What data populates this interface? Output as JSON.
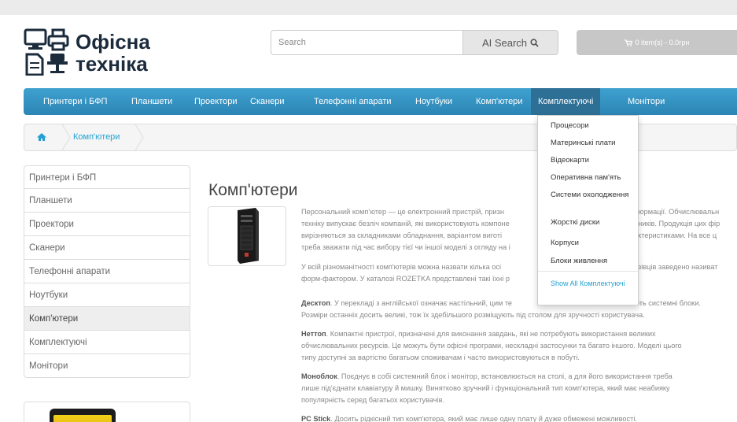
{
  "logo": {
    "line1": "Офісна",
    "line2": "техніка"
  },
  "search": {
    "placeholder": "Search",
    "button_label": "AI Search"
  },
  "cart": {
    "label": "0 item(s) - 0.0грн"
  },
  "nav": {
    "items": [
      "Принтери і БФП",
      "Планшети",
      "Проектори",
      "Сканери",
      "Телефонні апарати",
      "Ноутбуки",
      "Комп'ютери",
      "Комплектуючі",
      "Монітори"
    ],
    "active_index": 7
  },
  "dropdown": {
    "items": [
      "Процесори",
      "Материнські плати",
      "Відеокарти",
      "Оперативна пам'ять",
      "Системи охолодження",
      "Жорсткі диски",
      "Корпуси",
      "Блоки живлення"
    ],
    "show_all": "Show All Комплектуючі"
  },
  "breadcrumb": {
    "current": "Комп'ютери"
  },
  "sidebar": {
    "items": [
      "Принтери і БФП",
      "Планшети",
      "Проектори",
      "Сканери",
      "Телефонні апарати",
      "Ноутбуки",
      "Комп'ютери",
      "Комплектуючі",
      "Монітори"
    ],
    "active_index": 6
  },
  "page": {
    "title": "Комп'ютери",
    "paragraphs": [
      {
        "bold": "",
        "text": "Персональний комп'ютер — це електронний пристрій, призн"
      },
      {
        "bold": "",
        "text": "техніку випускає безліч компаній, які використовують компоне"
      },
      {
        "bold": "",
        "text": "вирізняються за складниками обладнання, варіантом виготі"
      },
      {
        "bold": "",
        "text": "треба зважати під час вибору тієї чи іншої моделі з огляду на і"
      },
      {
        "bold": "",
        "text": "У всій різноманітності комп'ютерів можна назвати кілька осі"
      },
      {
        "bold": "",
        "text": "форм-фактором. У каталозі ROZETKA представлені такі їхні р"
      },
      {
        "bold": "Десктоп",
        "text": ". У перекладі з англійської означає настільний, цим те"
      },
      {
        "bold": "",
        "text": "Розміри останніх досить великі, тож їх здебільшого розміщують під столом для зручності користувача."
      },
      {
        "bold": "Неттоп",
        "text": ". Компактні пристрої, призначені для виконання завдань, які не потребують використання великих"
      },
      {
        "bold": "",
        "text": "обчислювальних ресурсів. Це можуть бути офісні програми, нескладні застосунки та багато іншого. Моделі цього"
      },
      {
        "bold": "",
        "text": "типу доступні за вартістю багатьом споживачам і часто використовуються в побуті."
      },
      {
        "bold": "Моноблок",
        "text": ". Поєднує в собі системний блок і монітор, встановлюється на столі, а для його використання треба"
      },
      {
        "bold": "",
        "text": "лише під'єднати клавіатуру й мишку. Винятково зручний і функціональний тип комп'ютера, який має неабияку"
      },
      {
        "bold": "",
        "text": "популярність серед багатьох користувачів."
      },
      {
        "bold": "PC Stick",
        "text": ". Досить рідкісний тип комп'ютера, який має лише одну плату й дуже обмежені можливості."
      }
    ],
    "right_fragments": [
      "формації. Обчислювальн",
      "бників. Продукція цих фір",
      "актеристиками. На все ц",
      "",
      "азівців заведено називат",
      "",
      "ють системні блоки."
    ]
  }
}
